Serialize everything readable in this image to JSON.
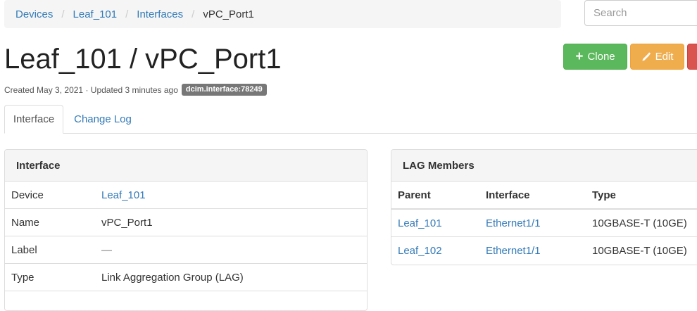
{
  "breadcrumb": {
    "items": [
      "Devices",
      "Leaf_101",
      "Interfaces"
    ],
    "current": "vPC_Port1",
    "separator": "/"
  },
  "search": {
    "placeholder": "Search"
  },
  "page_title": "Leaf_101 / vPC_Port1",
  "buttons": {
    "clone_label": "Clone",
    "edit_label": "Edit",
    "clone_icon": "plus-icon",
    "edit_icon": "pencil-icon"
  },
  "meta": {
    "created_label": "Created",
    "created_date": "May 3, 2021",
    "divider": "·",
    "updated_label": "Updated",
    "updated_value": "3 minutes ago",
    "badge": "dcim.interface:78249"
  },
  "tabs": [
    {
      "label": "Interface",
      "active": true
    },
    {
      "label": "Change Log",
      "active": false
    }
  ],
  "interface_panel": {
    "title": "Interface",
    "rows": [
      {
        "key": "Device",
        "value": "Leaf_101"
      },
      {
        "key": "Name",
        "value": "vPC_Port1"
      },
      {
        "key": "Label",
        "value": "—"
      },
      {
        "key": "Type",
        "value": "Link Aggregation Group (LAG)"
      }
    ]
  },
  "lag_panel": {
    "title": "LAG Members",
    "columns": [
      "Parent",
      "Interface",
      "Type"
    ],
    "rows": [
      {
        "parent": "Leaf_101",
        "interface": "Ethernet1/1",
        "type": "10GBASE-T (10GE)"
      },
      {
        "parent": "Leaf_102",
        "interface": "Ethernet1/1",
        "type": "10GBASE-T (10GE)"
      }
    ]
  },
  "colors": {
    "link": "#337ab7",
    "clone": "#5cb85c",
    "edit": "#f0ad4e",
    "delete": "#d9534f",
    "badge": "#777777"
  }
}
